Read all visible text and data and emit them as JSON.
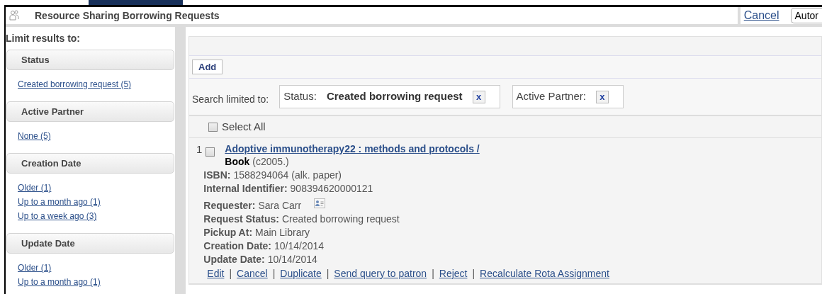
{
  "header": {
    "title": "Resource Sharing Borrowing Requests",
    "cancel": "Cancel",
    "button": "Autor"
  },
  "sidebar": {
    "heading": "Limit results to:",
    "facets": [
      {
        "title": "Status",
        "items": [
          "Created borrowing request (5)"
        ]
      },
      {
        "title": "Active Partner",
        "items": [
          "None (5)"
        ]
      },
      {
        "title": "Creation Date",
        "items": [
          "Older (1)",
          "Up to a month ago (1)",
          "Up to a week ago (3)"
        ]
      },
      {
        "title": "Update Date",
        "items": [
          "Older (1)",
          "Up to a month ago (1)"
        ]
      }
    ]
  },
  "toolbar": {
    "add": "Add"
  },
  "search": {
    "label": "Search limited to:",
    "filters": [
      {
        "name": "Status:",
        "value": "Created borrowing request",
        "remove": "x"
      },
      {
        "name": "Active Partner:",
        "remove": "x"
      }
    ]
  },
  "select_all": {
    "label": "Select All",
    "checked": false
  },
  "records": [
    {
      "number": "1",
      "checked": false,
      "title": "Adoptive immunotherapy22 : methods and protocols /",
      "type": "Book",
      "date": "(c2005.)",
      "fields": [
        {
          "kind": "text",
          "label": "ISBN:",
          "value": "1588294064 (alk. paper)"
        },
        {
          "kind": "text",
          "label": "Internal Identifier:",
          "value": "908394620000121"
        },
        {
          "kind": "person",
          "label": "Requester:",
          "value": "Sara Carr"
        },
        {
          "kind": "text",
          "label": "Request Status:",
          "value": "Created borrowing request"
        },
        {
          "kind": "text",
          "label": "Pickup At:",
          "value": "Main Library"
        },
        {
          "kind": "text",
          "label": "Creation Date:",
          "value": "10/14/2014"
        },
        {
          "kind": "text",
          "label": "Update Date:",
          "value": "10/14/2014"
        }
      ],
      "separator": "|",
      "actions": [
        "Edit",
        "Cancel",
        "Duplicate",
        "Send query to patron",
        "Reject",
        "Recalculate Rota Assignment"
      ]
    }
  ]
}
